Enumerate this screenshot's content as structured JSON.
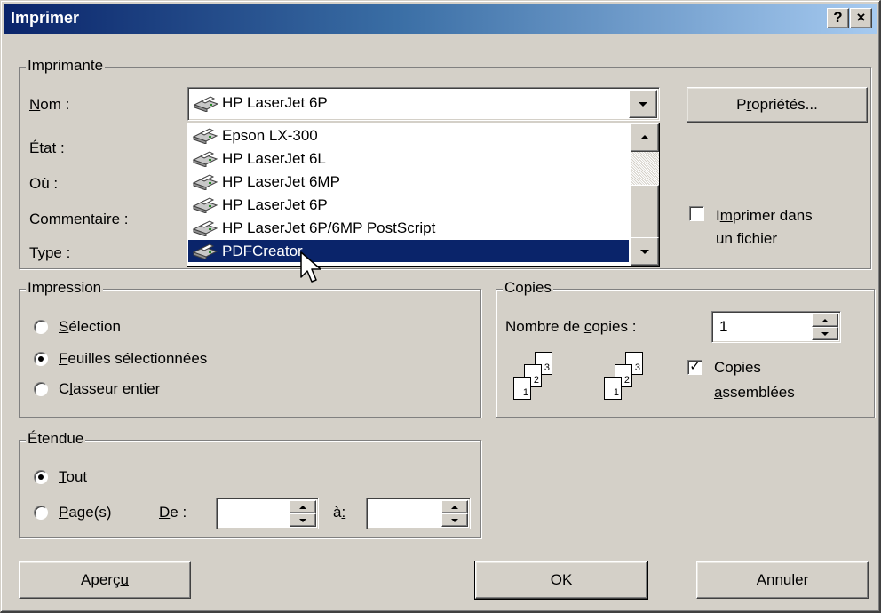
{
  "dialog": {
    "title": "Imprimer",
    "help_label": "?",
    "close_label": "×"
  },
  "printer": {
    "group_label": "Imprimante",
    "name_label": "Nom :",
    "name_accel": "N",
    "name_rest": "om :",
    "state_label": "État :",
    "where_label": "Où :",
    "comment_label": "Commentaire :",
    "type_label": "Type :",
    "selected_printer": "HP LaserJet 6P",
    "properties_pre": "P",
    "properties_accel": "r",
    "properties_post": "opriétés...",
    "list": [
      {
        "label": "Epson LX-300",
        "selected": false
      },
      {
        "label": "HP LaserJet 6L",
        "selected": false
      },
      {
        "label": "HP LaserJet 6MP",
        "selected": false
      },
      {
        "label": "HP LaserJet 6P",
        "selected": false
      },
      {
        "label": "HP LaserJet 6P/6MP PostScript",
        "selected": false
      },
      {
        "label": "PDFCreator",
        "selected": true
      }
    ],
    "print_to_file": {
      "checked": false,
      "line1_pre": "I",
      "line1_accel": "m",
      "line1_post": "primer dans",
      "line2": "un fichier"
    }
  },
  "print_what": {
    "group_label": "Impression",
    "options": [
      {
        "accel": "S",
        "rest": "élection",
        "checked": false
      },
      {
        "accel": "F",
        "rest": "euilles sélectionnées",
        "checked": true
      },
      {
        "pre": "C",
        "accel": "l",
        "rest": "asseur entier",
        "checked": false
      }
    ]
  },
  "copies": {
    "group_label": "Copies",
    "count_label_pre": "Nombre de ",
    "count_label_accel": "c",
    "count_label_post": "opies :",
    "count_value": "1",
    "collate_checked": true,
    "collate_line1": "Copies",
    "collate_line2_accel": "a",
    "collate_line2_rest": "ssemblées",
    "page_numbers": [
      "1",
      "2",
      "3"
    ]
  },
  "range": {
    "group_label": "Étendue",
    "all_accel": "T",
    "all_rest": "out",
    "all_checked": true,
    "pages_accel": "P",
    "pages_rest": "age(s)",
    "pages_checked": false,
    "from_accel": "D",
    "from_rest": "e :",
    "from_value": "",
    "to_pre": "à",
    "to_accel": ":",
    "to_value": ""
  },
  "buttons": {
    "preview_pre": "Aperç",
    "preview_accel": "u",
    "ok_label": "OK",
    "cancel_label": "Annuler"
  },
  "colors": {
    "title_start": "#0a246a",
    "title_end": "#a6caf0",
    "face": "#d4d0c8",
    "selection": "#0a246a"
  }
}
